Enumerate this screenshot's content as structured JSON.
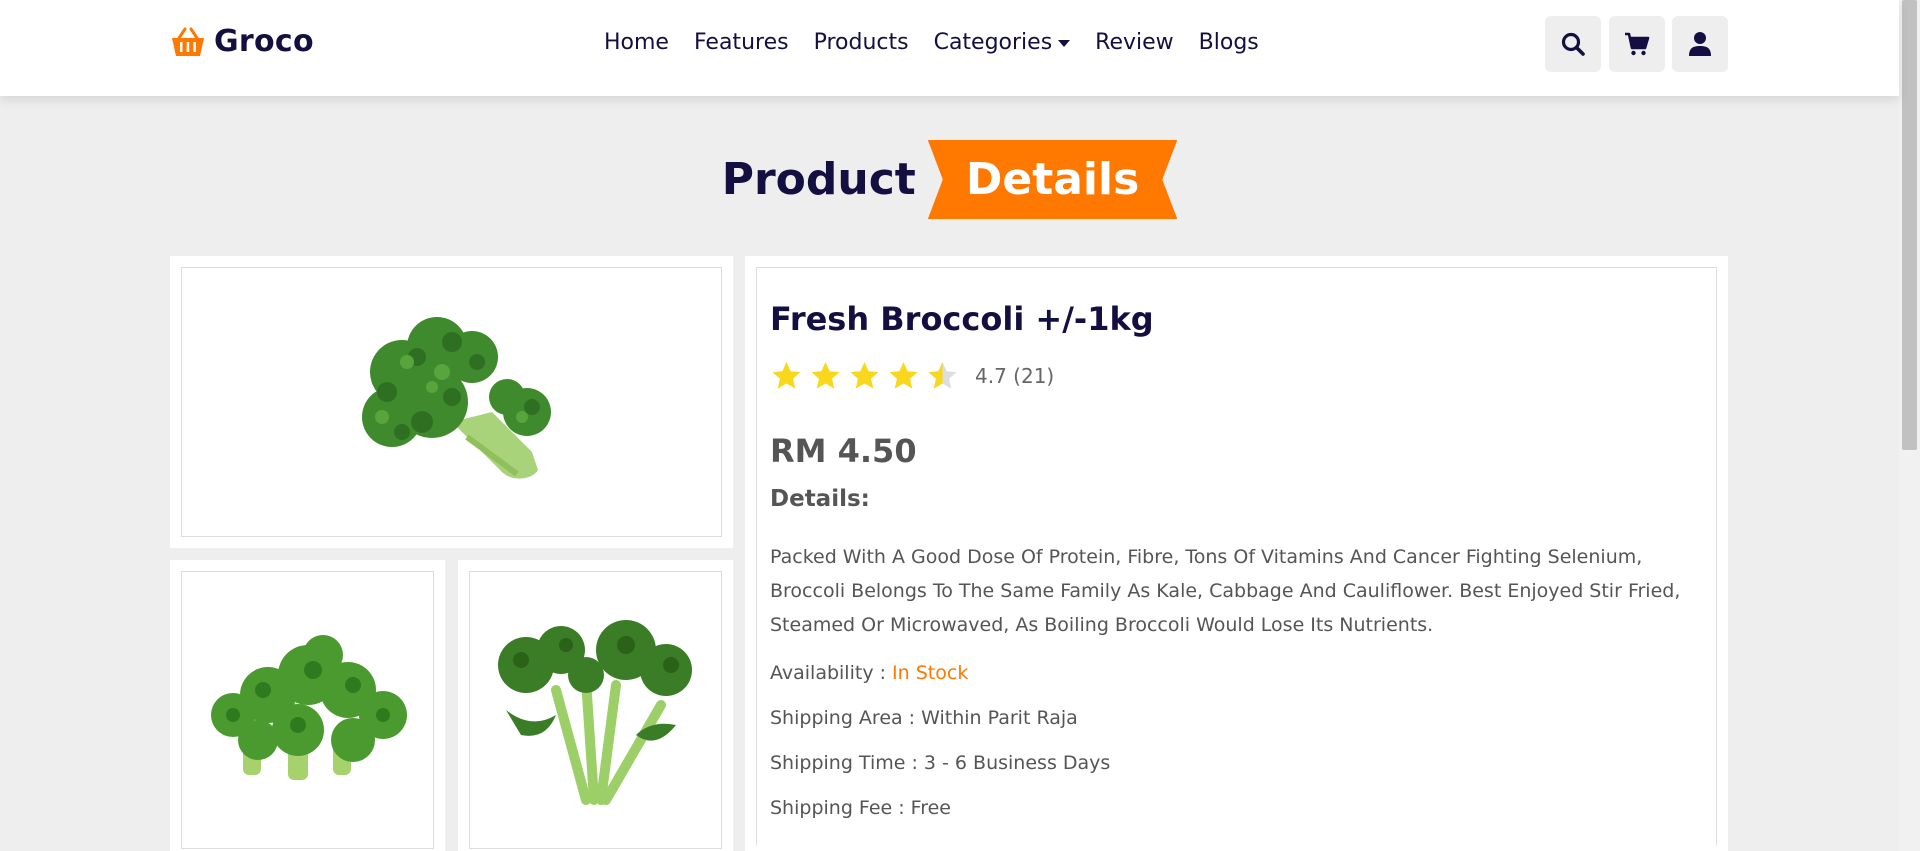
{
  "header": {
    "logo_text": "Groco",
    "nav": [
      {
        "label": "Home"
      },
      {
        "label": "Features"
      },
      {
        "label": "Products"
      },
      {
        "label": "Categories"
      },
      {
        "label": "Review"
      },
      {
        "label": "Blogs"
      }
    ],
    "icons": [
      "search-icon",
      "cart-icon",
      "user-icon"
    ]
  },
  "heading": {
    "part1": "Product",
    "part2": "Details"
  },
  "product": {
    "title": "Fresh Broccoli +/-1kg",
    "rating_value": 4.7,
    "rating_text": "4.7 (21)",
    "price": "RM 4.50",
    "details_label": "Details:",
    "description": "Packed With A Good Dose Of Protein, Fibre, Tons Of Vitamins And Cancer Fighting Selenium, Broccoli Belongs To The Same Family As Kale, Cabbage And Cauliflower. Best Enjoyed Stir Fried, Steamed Or Microwaved, As Boiling Broccoli Would Lose Its Nutrients.",
    "availability_label": "Availability : ",
    "availability_value": "In Stock",
    "shipping_area": "Shipping Area : Within Parit Raja",
    "shipping_time": "Shipping Time : 3 - 6 Business Days",
    "shipping_fee": "Shipping Fee : Free"
  },
  "colors": {
    "accent": "#ff7800",
    "dark": "#130f40",
    "star": "#f9d71c",
    "background": "#eeeeee"
  }
}
